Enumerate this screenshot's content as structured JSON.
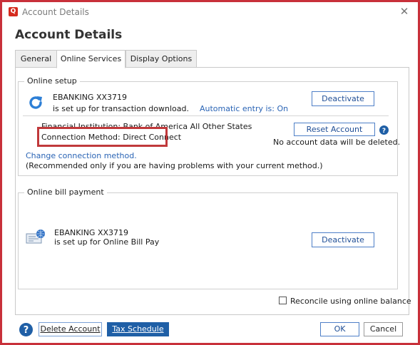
{
  "window": {
    "title": "Account Details",
    "logo_letter": "Q",
    "close": "✕"
  },
  "heading": "Account Details",
  "tabs": [
    {
      "label": "General"
    },
    {
      "label": "Online Services"
    },
    {
      "label": "Display Options"
    }
  ],
  "online_setup": {
    "title": "Online setup",
    "account_name": "EBANKING XX3719",
    "status_line": "is set up for transaction download.",
    "automatic_entry": "Automatic entry is: On",
    "deactivate_label": "Deactivate",
    "financial_institution": "Financial Institution: Bank of America All Other States",
    "connection_method": "Connection Method: Direct Connect",
    "reset_account_label": "Reset Account",
    "reset_note": "No account data will be deleted.",
    "change_link": "Change connection method.",
    "recommendation": "(Recommended only if you are having problems with your current method.)"
  },
  "online_bill_payment": {
    "title": "Online bill payment",
    "account_name": "EBANKING XX3719",
    "status_line": "is set up for Online Bill Pay",
    "deactivate_label": "Deactivate"
  },
  "reconcile": {
    "label": "Reconcile using online balance",
    "checked": false
  },
  "footer": {
    "delete_label": "Delete Account",
    "tax_label": "Tax Schedule",
    "ok_label": "OK",
    "cancel_label": "Cancel"
  },
  "colors": {
    "frame": "#c8303a",
    "accent": "#1f5fa6",
    "link": "#2a64b5",
    "highlight_box": "#c0393b"
  }
}
